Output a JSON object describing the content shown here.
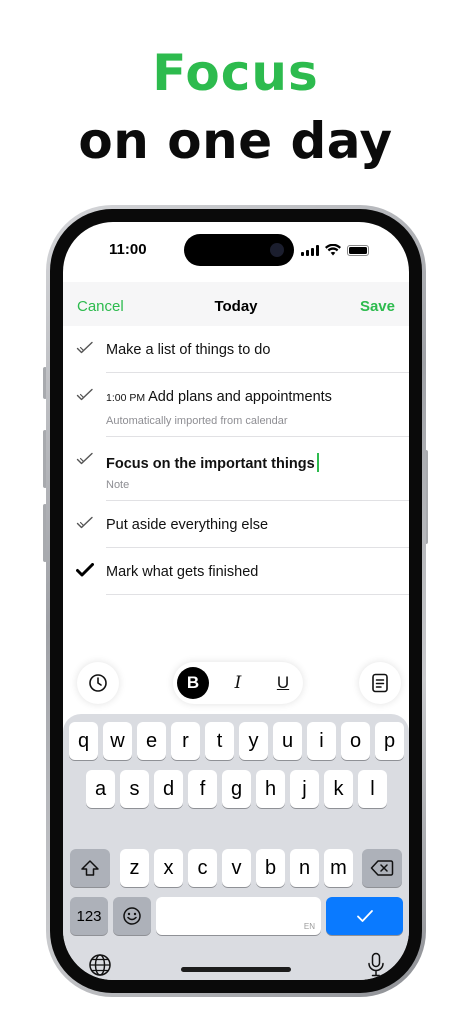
{
  "promo": {
    "headline_line1": "Focus",
    "headline_line2": "on one day"
  },
  "colors": {
    "accent_green": "#2dbb4e",
    "key_blue": "#0a7aff",
    "keyboard_bg": "#dadce1"
  },
  "status_bar": {
    "time": "11:00"
  },
  "nav": {
    "cancel_label": "Cancel",
    "title": "Today",
    "save_label": "Save"
  },
  "tasks": [
    {
      "title": "Make a list of things to do",
      "done": false
    },
    {
      "time": "1:00 PM",
      "title": "Add plans and appointments",
      "subtitle": "Automatically imported from calendar",
      "done": false
    },
    {
      "title": "Focus on the important things",
      "subtitle": "Note",
      "editing": true,
      "done": false
    },
    {
      "title": "Put aside everything else",
      "done": false
    },
    {
      "title": "Mark what gets finished",
      "done": true
    }
  ],
  "toolbar": {
    "bold_label": "B",
    "italic_label": "I",
    "underline_label": "U",
    "left_icon": "clock-icon",
    "right_icon": "note-icon"
  },
  "keyboard": {
    "row1": [
      "q",
      "w",
      "e",
      "r",
      "t",
      "y",
      "u",
      "i",
      "o",
      "p"
    ],
    "row2": [
      "a",
      "s",
      "d",
      "f",
      "g",
      "h",
      "j",
      "k",
      "l"
    ],
    "row3": [
      "z",
      "x",
      "c",
      "v",
      "b",
      "n",
      "m"
    ],
    "numbers_label": "123",
    "space_language": "EN",
    "return_icon": "checkmark-icon",
    "emoji_icon": "emoji-icon",
    "globe_icon": "globe-icon",
    "mic_icon": "microphone-icon",
    "shift_icon": "shift-icon",
    "delete_icon": "backspace-icon"
  }
}
